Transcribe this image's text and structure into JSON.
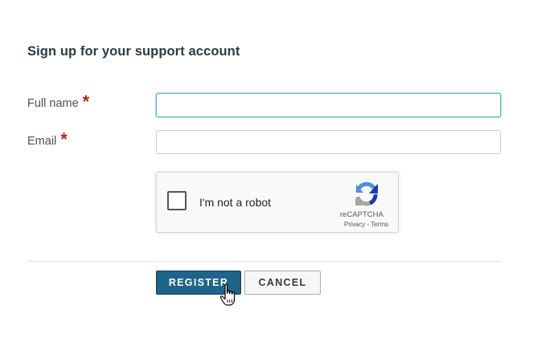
{
  "form": {
    "title": "Sign up for your support account",
    "full_name": {
      "label": "Full name",
      "required_marker": "*",
      "value": "",
      "placeholder": ""
    },
    "email": {
      "label": "Email",
      "required_marker": "*",
      "value": "",
      "placeholder": ""
    }
  },
  "recaptcha": {
    "checkbox_label": "I'm not a robot",
    "brand": "reCAPTCHA",
    "privacy_link": "Privacy",
    "separator": " - ",
    "terms_link": "Terms",
    "icon": "recaptcha-logo-icon"
  },
  "actions": {
    "register_label": "REGISTER",
    "cancel_label": "CANCEL"
  },
  "colors": {
    "primary": "#1f6489",
    "required": "#c0221a",
    "focus_border": "#66b8c9"
  }
}
